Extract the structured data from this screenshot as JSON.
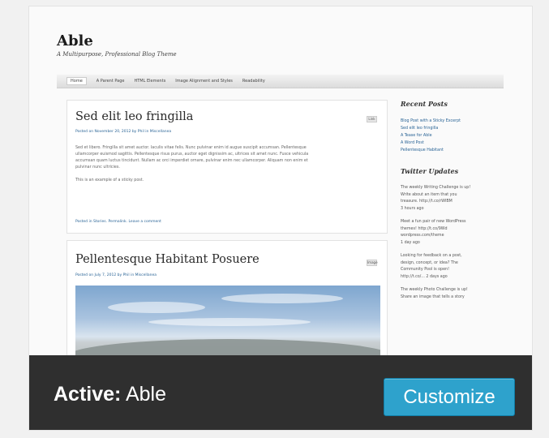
{
  "theme_preview": {
    "site_title": "Able",
    "site_tagline": "A Multipurpose, Professional Blog Theme",
    "nav": [
      "Home",
      "A Parent Page",
      "HTML Elements",
      "Image Alignment and Styles",
      "Readability"
    ],
    "posts": [
      {
        "title": "Sed elit leo fringilla",
        "meta": "Posted on November 20, 2012 by Phil in Miscellanea",
        "badge": "Link",
        "body": [
          "Sed et libero. Fringilla sit amet auctor. Iaculis vitae felis. Nunc pulvinar enim id augue suscipit accumsan. Pellentesque",
          "ullamcorper euismod sagittis. Pellentesque risus purus, auctor eget dignissim ac, ultrices sit amet nunc. Fusce vehicula",
          "accumsan quam luctus tincidunt. Nullam ac orci imperdiet ornare, pulvinar enim nec ullamcorper. Aliquam non enim et",
          "pulvinar nunc ultricies."
        ],
        "body_extra": "This is an example of a sticky post.",
        "footer": "Posted in Stories. Permalink. Leave a comment"
      },
      {
        "title": "Pellentesque Habitant Posuere",
        "meta": "Posted on July 7, 2012 by Phil in Miscellanea",
        "badge": "Image"
      }
    ],
    "sidebar": {
      "recent_heading": "Recent Posts",
      "recent_links": [
        "Blog Post with a Sticky Excerpt",
        "Sed elit leo fringilla",
        "A Tease for Able",
        "A Word Post",
        "Pellentesque Habitant"
      ],
      "twitter_heading": "Twitter Updates",
      "tweets": [
        [
          "The weekly Writing Challenge is up!",
          "Write about an item that you",
          "treasure. http://t.co/rWlBM",
          "3 hours ago"
        ],
        [
          "Meet a fun pair of new WordPress",
          "themes! http://t.co/9Wd",
          "wordpress.com/theme",
          "1 day ago"
        ],
        [
          "Looking for feedback on a post,",
          "design, concept, or idea? The",
          "Community Pool is open!",
          "http://t.co/... 2 days ago"
        ],
        [
          "The weekly Photo Challenge is up!",
          "Share an image that tells a story"
        ]
      ]
    }
  },
  "footer": {
    "active_prefix": "Active:",
    "active_theme": "Able",
    "customize_label": "Customize"
  },
  "colors": {
    "footer_bg": "#2f2f2f",
    "button_bg": "#2ea2cc",
    "link": "#2a6496"
  }
}
